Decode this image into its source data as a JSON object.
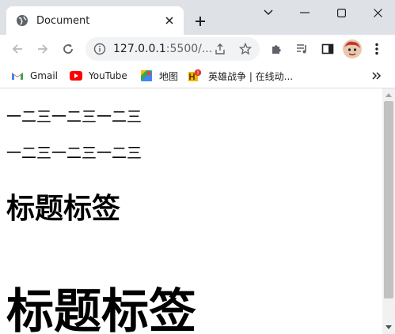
{
  "browser": {
    "tab": {
      "title": "Document"
    },
    "address": {
      "url_main": "127.0.0.1",
      "url_rest": ":5500/..."
    },
    "bookmarks": [
      {
        "label": "Gmail"
      },
      {
        "label": "YouTube"
      },
      {
        "label": "地图"
      },
      {
        "label": "英雄战争 | 在线动..."
      }
    ]
  },
  "page": {
    "line1": "一二三一二三一二三",
    "line2": "一二三一二三一二三",
    "heading_small": "标题标签",
    "heading_large": "标题标签"
  }
}
